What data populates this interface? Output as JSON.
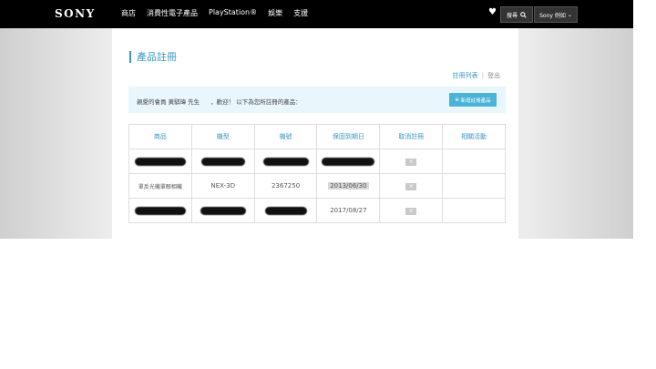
{
  "header": {
    "logo": "SONY",
    "nav": [
      "商店",
      "消費性電子產品",
      "PlayStation®",
      "娛樂",
      "支援"
    ],
    "search_label": "搜尋",
    "user_label": "Sony 例如",
    "heart_icon": "heart-icon"
  },
  "page": {
    "title": "產品註冊",
    "link_list": "註冊列表",
    "link_logout": "登出"
  },
  "welcome": {
    "text_prefix": "親愛的會員 黃騏瑋 先生",
    "text_suffix": "，歡迎！ 以下為您所註冊的產品：",
    "new_button": "新增註冊產品"
  },
  "table": {
    "headers": [
      "商品",
      "機型",
      "機號",
      "保固到期日",
      "取消註冊",
      "相關活動"
    ],
    "rows": [
      {
        "product": "",
        "model": "",
        "serial": "",
        "warranty": "",
        "cancel": "×",
        "events": ""
      },
      {
        "product": "單反光機單眼相機",
        "model": "NEX-3D",
        "serial": "2367250",
        "warranty": "2013/06/30",
        "cancel": "×",
        "events": ""
      },
      {
        "product": "",
        "model": "",
        "serial": "",
        "warranty": "2017/08/27",
        "cancel": "×",
        "events": ""
      }
    ]
  },
  "colors": {
    "accent": "#3a97c4",
    "welcome_bg": "#e9f6fb",
    "button": "#4ab3d8"
  }
}
